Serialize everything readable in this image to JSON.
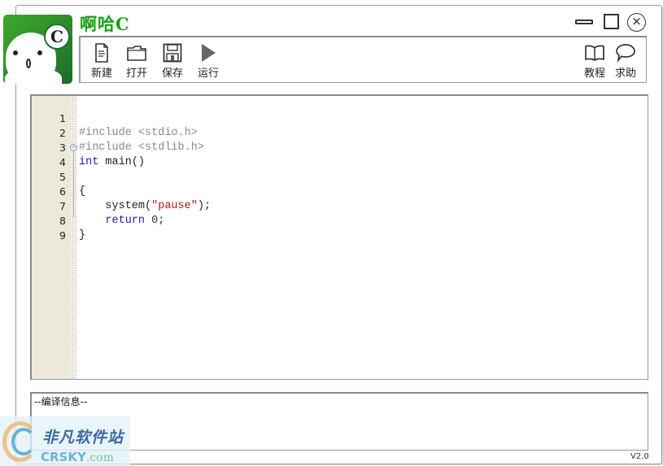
{
  "app": {
    "title": "啊哈C",
    "logo_letter": "C",
    "version": "V2.0"
  },
  "window_controls": {
    "minimize": "minimize",
    "maximize": "maximize",
    "close": "×"
  },
  "toolbar": {
    "left": [
      {
        "id": "new",
        "label": "新建",
        "icon": "new-file-icon"
      },
      {
        "id": "open",
        "label": "打开",
        "icon": "folder-icon"
      },
      {
        "id": "save",
        "label": "保存",
        "icon": "floppy-disk-icon"
      },
      {
        "id": "run",
        "label": "运行",
        "icon": "play-icon"
      }
    ],
    "right": [
      {
        "id": "tutorial",
        "label": "教程",
        "icon": "book-icon"
      },
      {
        "id": "help",
        "label": "求助",
        "icon": "speech-bubble-icon"
      }
    ]
  },
  "editor": {
    "line_numbers": [
      "1",
      "2",
      "3",
      "4",
      "5",
      "6",
      "7",
      "8",
      "9"
    ],
    "lines": {
      "l1": "#include <stdio.h>",
      "l2": "#include <stdlib.h>",
      "l3_kw": "int",
      "l3_rest": " main()",
      "l4": "{",
      "l6_fn": "    system(",
      "l6_str": "\"pause\"",
      "l6_end": ");",
      "l7_kw": "    return",
      "l7_rest": " 0;",
      "l8": "}"
    },
    "fold_marker": "⊖"
  },
  "output": {
    "header": "--编译信息--"
  },
  "watermark": {
    "cn": "非凡软件站",
    "en": "CRSKY",
    "en_suffix": ".com"
  },
  "colors": {
    "title_green": "#1aa01a",
    "keyword": "#1c1ca8",
    "string": "#b01818",
    "preprocessor": "#8a8a8a",
    "gutter": "#ece9da"
  }
}
